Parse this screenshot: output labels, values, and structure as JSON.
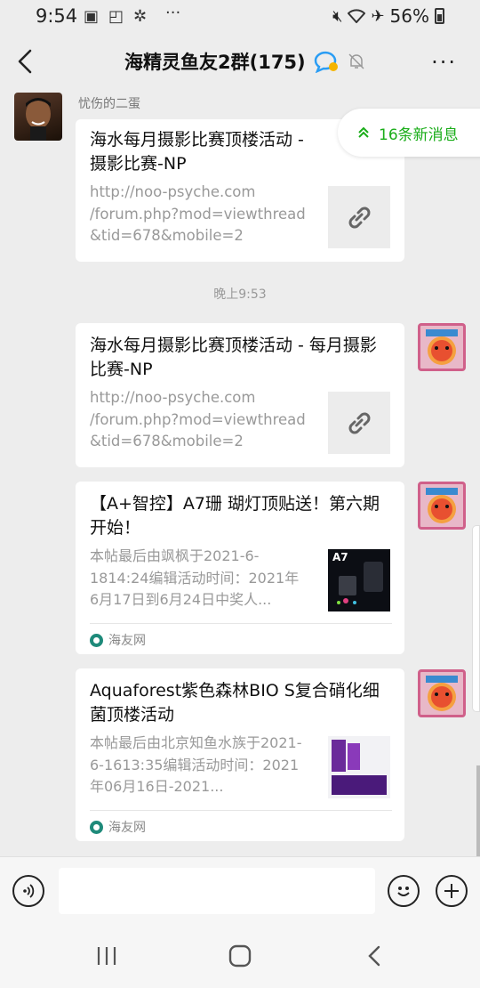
{
  "status": {
    "time": "9:54",
    "more": "···",
    "battery": "56%"
  },
  "header": {
    "title": "海精灵鱼友2群(175)",
    "more": "···"
  },
  "new_messages": {
    "label": "16条新消息"
  },
  "messages": [
    {
      "sender": "忧伤的二蛋",
      "title": "海水每月摄影比赛顶楼活动 - 摄影比赛-NP",
      "url_lines": [
        "http://noo-psyche.com",
        "/forum.php?mod=viewthread",
        "&tid=678&mobile=2"
      ]
    },
    {
      "title": "海水每月摄影比赛顶楼活动 - 每月摄影比赛-NP",
      "url_lines": [
        "http://noo-psyche.com",
        "/forum.php?mod=viewthread",
        "&tid=678&mobile=2"
      ]
    },
    {
      "title": "【A+智控】A7珊 瑚灯顶贴送！第六期开始！",
      "desc": "本帖最后由飒枫于2021-6-1814:24编辑活动时间：2021年6月17日到6月24日中奖人...",
      "thumb_label": "A7",
      "source": "海友网"
    },
    {
      "title": "Aquaforest紫色森林BIO S复合硝化细菌顶楼活动",
      "desc": "本帖最后由北京知鱼水族于2021-6-1613:35编辑活动时间：2021年06月16日-2021...",
      "source": "海友网"
    }
  ],
  "timestamp": "晚上9:53",
  "colors": {
    "accent_green": "#1aad19",
    "background": "#ededed",
    "bubble": "#ffffff"
  }
}
